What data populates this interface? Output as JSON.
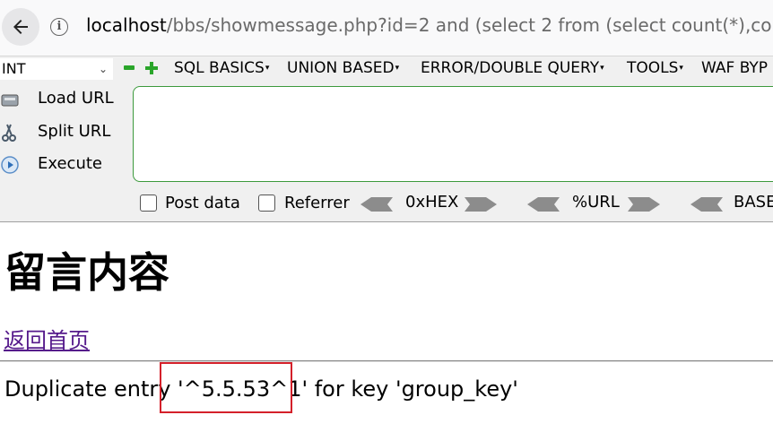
{
  "browser": {
    "url_host": "localhost",
    "url_rest": "/bbs/showmessage.php?id=2 and (select 2 from (select count(*),cor"
  },
  "hackbar": {
    "select_value": "INT",
    "menus": [
      "SQL BASICS",
      "UNION BASED",
      "ERROR/DOUBLE QUERY",
      "TOOLS",
      "WAF BYP"
    ],
    "buttons": {
      "load_url": "Load URL",
      "split_url": "Split URL",
      "execute": "Execute"
    },
    "post_data_label": "Post data",
    "referrer_label": "Referrer",
    "encodings": [
      "0xHEX",
      "%URL",
      "BASE"
    ]
  },
  "page": {
    "title": "留言内容",
    "home_link": "返回首页",
    "error_message": "Duplicate entry '^5.5.53^1' for key 'group_key'"
  },
  "colors": {
    "link_visited": "#551a8b",
    "highlight_border": "#d4202a",
    "hackbar_green": "#2aa52a"
  }
}
